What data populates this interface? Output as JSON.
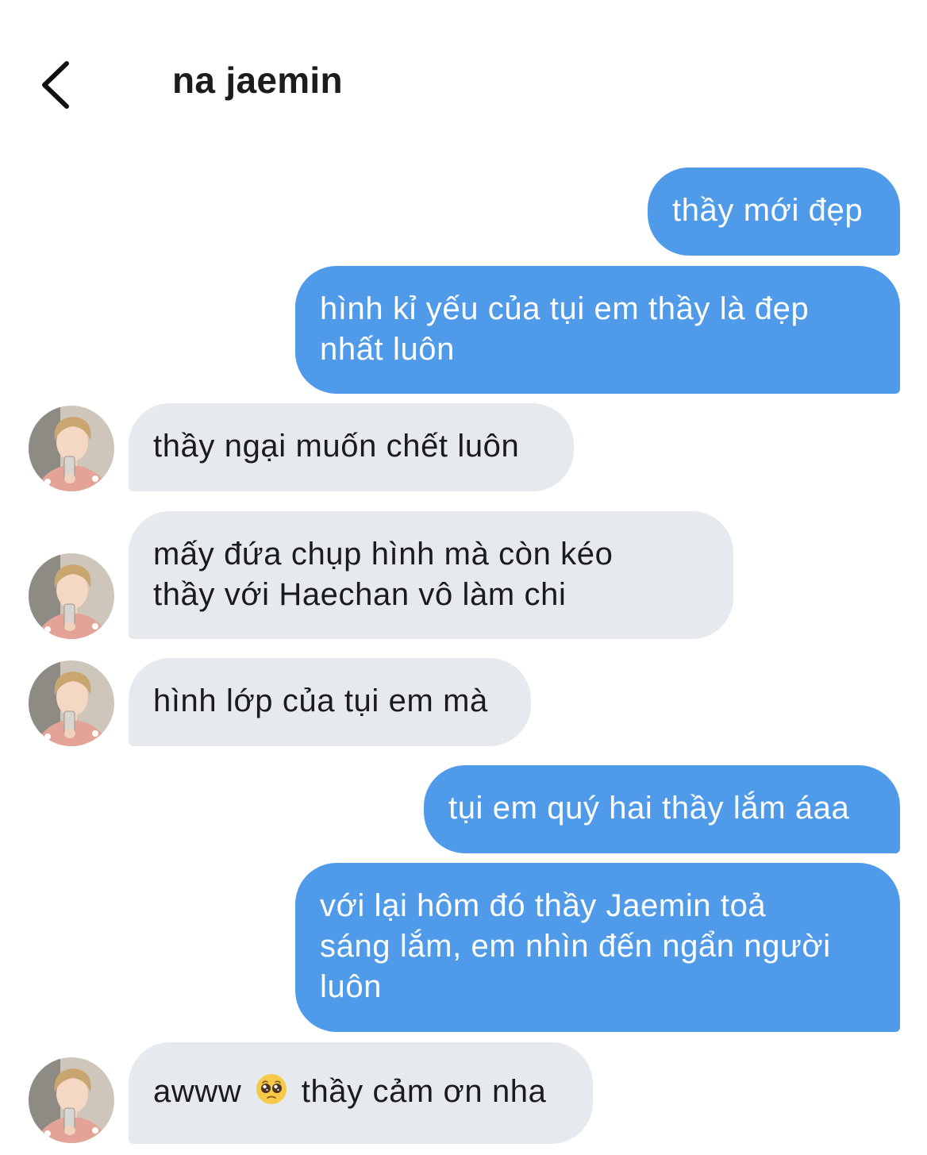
{
  "header": {
    "back_icon": "chevron-left-icon",
    "title": "na jaemin"
  },
  "colors": {
    "outgoing_bubble": "#4f9bea",
    "incoming_bubble": "#e6e9ee",
    "outgoing_text": "#ffffff",
    "incoming_text": "#1b1b1d"
  },
  "messages": [
    {
      "side": "out",
      "text": "thầy mới đẹp"
    },
    {
      "side": "out",
      "lines": [
        "hình kỉ yếu của tụi em thầy là đẹp",
        "nhất luôn"
      ]
    },
    {
      "side": "in",
      "text": "thầy ngại muốn chết luôn"
    },
    {
      "side": "in",
      "lines": [
        "mấy đứa chụp hình mà còn kéo",
        "thầy với Haechan vô làm chi"
      ]
    },
    {
      "side": "in",
      "text": "hình lớp của tụi em mà"
    },
    {
      "side": "out",
      "text": "tụi em quý hai thầy lắm áaa"
    },
    {
      "side": "out",
      "lines": [
        "với lại hôm đó thầy Jaemin toả",
        "sáng lắm, em nhìn đến ngẩn người",
        "luôn"
      ]
    },
    {
      "side": "in",
      "text_before_emoji": "awww",
      "emoji": "pleading-face-emoji",
      "text_after_emoji": "thầy cảm ơn nha"
    }
  ]
}
